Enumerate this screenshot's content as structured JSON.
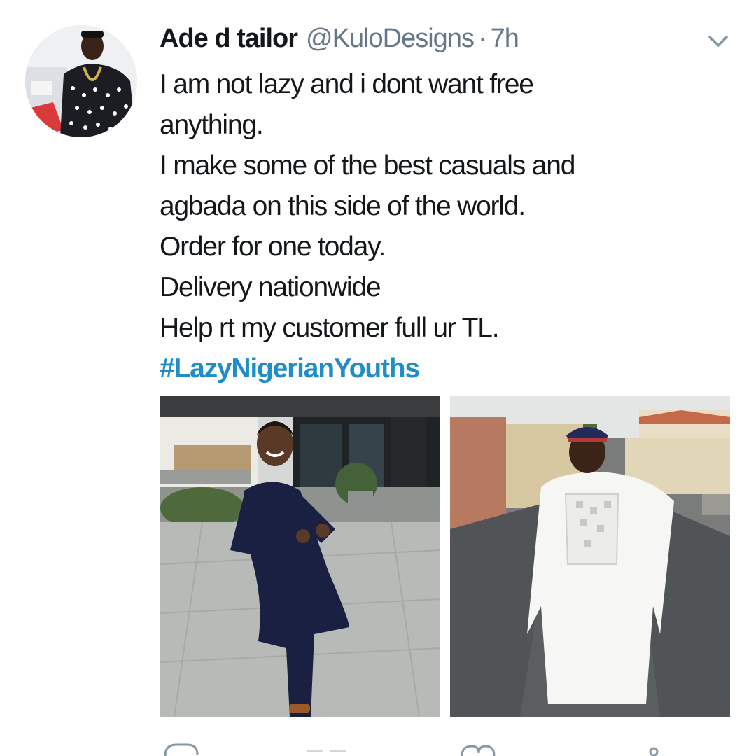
{
  "tweet": {
    "display_name": "Ade d tailor",
    "handle": "@KuloDesigns",
    "separator": "·",
    "timestamp": "7h",
    "lines": [
      "I am not lazy and i dont want free",
      "anything.",
      "I make some of the best casuals and",
      "agbada on this side of the world.",
      "Order for one today.",
      "Delivery nationwide",
      "Help rt my customer full ur TL."
    ],
    "hashtag": "#LazyNigerianYouths"
  },
  "icons": {
    "more": "chevron-down-icon",
    "reply": "reply-icon",
    "retweet": "retweet-icon",
    "like": "heart-icon",
    "share": "share-icon"
  },
  "colors": {
    "hashtag": "#1f8ec6",
    "secondary_text": "#657786",
    "primary_text": "#14171a"
  }
}
